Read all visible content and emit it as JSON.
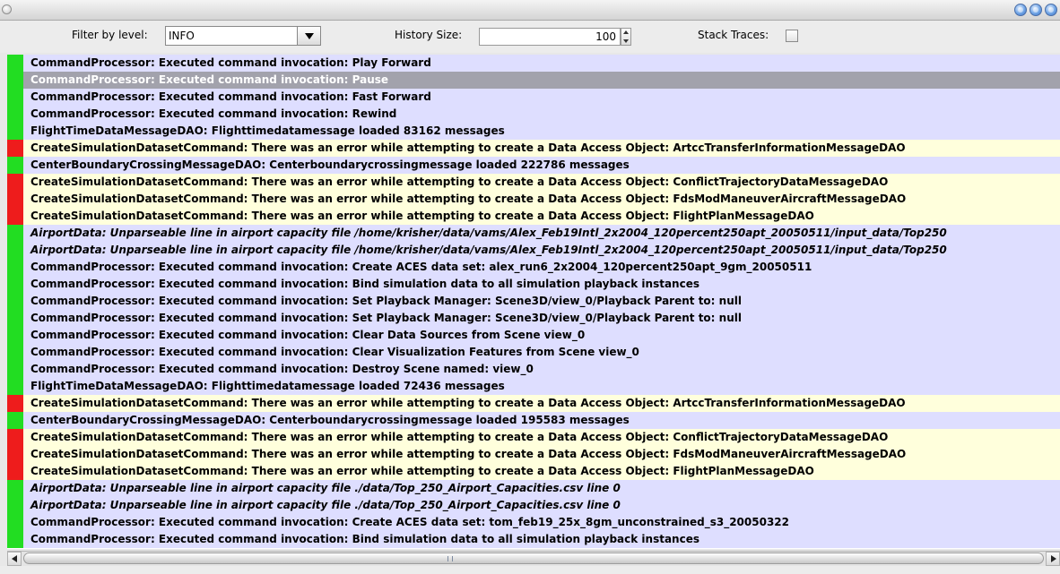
{
  "toolbar": {
    "filter_label": "Filter by level:",
    "filter_value": "INFO",
    "history_label": "History Size:",
    "history_value": "100",
    "stack_label": "Stack Traces:",
    "stack_checked": false
  },
  "colors": {
    "info_marker": "#22dd22",
    "error_marker": "#ee1c1c",
    "info_row": "#dedeff",
    "error_row": "#ffffdc",
    "selected_row": "#a2a2ac"
  },
  "log_rows": [
    {
      "level": "info",
      "text": "CommandProcessor: Executed command invocation: Play Forward"
    },
    {
      "level": "info",
      "selected": true,
      "text": "CommandProcessor: Executed command invocation: Pause"
    },
    {
      "level": "info",
      "text": "CommandProcessor: Executed command invocation: Fast Forward"
    },
    {
      "level": "info",
      "text": "CommandProcessor: Executed command invocation: Rewind"
    },
    {
      "level": "info",
      "text": "FlightTimeDataMessageDAO: Flighttimedatamessage loaded 83162 messages"
    },
    {
      "level": "error",
      "text": "CreateSimulationDatasetCommand: There was an error while attempting to create a Data Access Object: ArtccTransferInformationMessageDAO"
    },
    {
      "level": "info",
      "text": "CenterBoundaryCrossingMessageDAO: Centerboundarycrossingmessage loaded 222786 messages"
    },
    {
      "level": "error",
      "text": "CreateSimulationDatasetCommand: There was an error while attempting to create a Data Access Object: ConflictTrajectoryDataMessageDAO"
    },
    {
      "level": "error",
      "text": "CreateSimulationDatasetCommand: There was an error while attempting to create a Data Access Object: FdsModManeuverAircraftMessageDAO"
    },
    {
      "level": "error",
      "text": "CreateSimulationDatasetCommand: There was an error while attempting to create a Data Access Object: FlightPlanMessageDAO"
    },
    {
      "level": "info",
      "italic": true,
      "text": "AirportData: Unparseable line in airport capacity file /home/krisher/data/vams/Alex_Feb19Intl_2x2004_120percent250apt_20050511/input_data/Top250"
    },
    {
      "level": "info",
      "italic": true,
      "text": "AirportData: Unparseable line in airport capacity file /home/krisher/data/vams/Alex_Feb19Intl_2x2004_120percent250apt_20050511/input_data/Top250"
    },
    {
      "level": "info",
      "text": "CommandProcessor: Executed command invocation: Create ACES data set: alex_run6_2x2004_120percent250apt_9gm_20050511"
    },
    {
      "level": "info",
      "text": "CommandProcessor: Executed command invocation: Bind simulation data to all simulation playback instances"
    },
    {
      "level": "info",
      "text": "CommandProcessor: Executed command invocation: Set Playback Manager: Scene3D/view_0/Playback Parent to: null"
    },
    {
      "level": "info",
      "text": "CommandProcessor: Executed command invocation: Set Playback Manager: Scene3D/view_0/Playback Parent to: null"
    },
    {
      "level": "info",
      "text": "CommandProcessor: Executed command invocation: Clear Data Sources from Scene view_0"
    },
    {
      "level": "info",
      "text": "CommandProcessor: Executed command invocation: Clear Visualization Features from Scene view_0"
    },
    {
      "level": "info",
      "text": "CommandProcessor: Executed command invocation: Destroy Scene named: view_0"
    },
    {
      "level": "info",
      "text": "FlightTimeDataMessageDAO: Flighttimedatamessage loaded 72436 messages"
    },
    {
      "level": "error",
      "text": "CreateSimulationDatasetCommand: There was an error while attempting to create a Data Access Object: ArtccTransferInformationMessageDAO"
    },
    {
      "level": "info",
      "text": "CenterBoundaryCrossingMessageDAO: Centerboundarycrossingmessage loaded 195583 messages"
    },
    {
      "level": "error",
      "text": "CreateSimulationDatasetCommand: There was an error while attempting to create a Data Access Object: ConflictTrajectoryDataMessageDAO"
    },
    {
      "level": "error",
      "text": "CreateSimulationDatasetCommand: There was an error while attempting to create a Data Access Object: FdsModManeuverAircraftMessageDAO"
    },
    {
      "level": "error",
      "text": "CreateSimulationDatasetCommand: There was an error while attempting to create a Data Access Object: FlightPlanMessageDAO"
    },
    {
      "level": "info",
      "italic": true,
      "text": "AirportData: Unparseable line in airport capacity file ./data/Top_250_Airport_Capacities.csv line 0"
    },
    {
      "level": "info",
      "italic": true,
      "text": "AirportData: Unparseable line in airport capacity file ./data/Top_250_Airport_Capacities.csv line 0"
    },
    {
      "level": "info",
      "text": "CommandProcessor: Executed command invocation: Create ACES data set: tom_feb19_25x_8gm_unconstrained_s3_20050322"
    },
    {
      "level": "info",
      "text": "CommandProcessor: Executed command invocation: Bind simulation data to all simulation playback instances"
    }
  ]
}
